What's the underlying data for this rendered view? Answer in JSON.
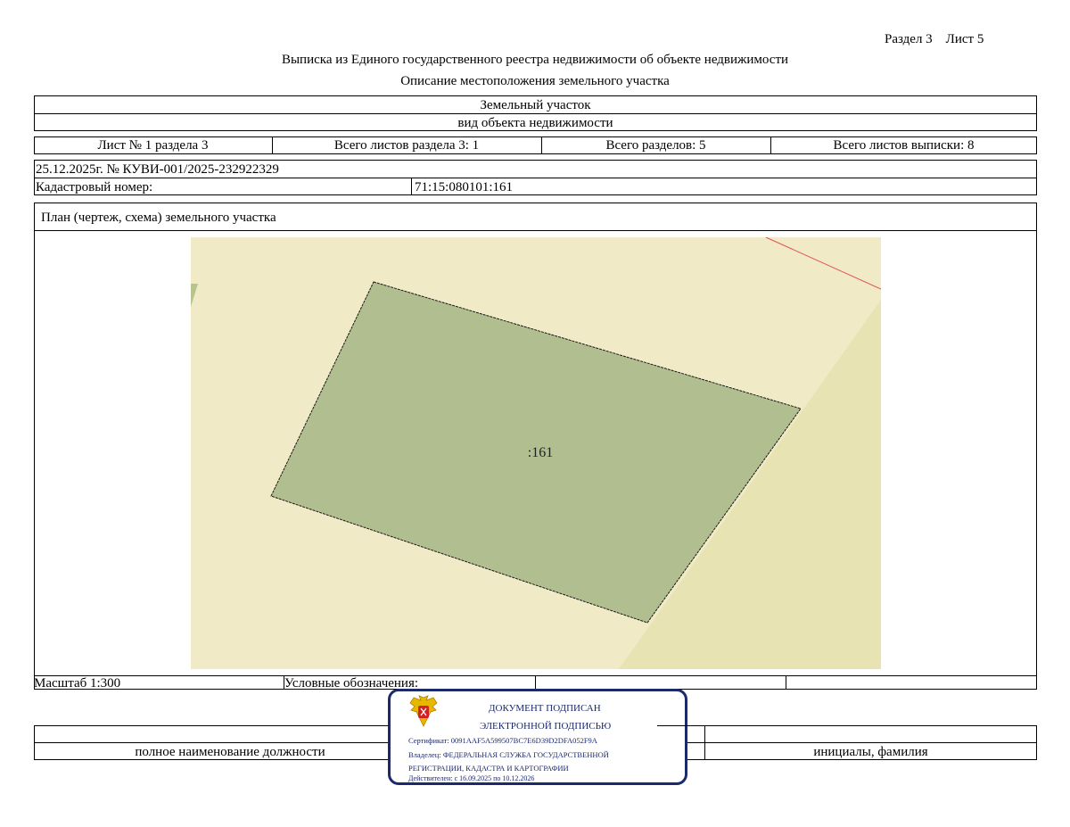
{
  "header": {
    "section_sheet": "Раздел 3    Лист 5",
    "title": "Выписка из Единого государственного реестра недвижимости об объекте недвижимости",
    "subtitle": "Описание местоположения земельного участка"
  },
  "object": {
    "type": "Земельный участок",
    "type_caption": "вид объекта недвижимости"
  },
  "sheets": {
    "sheet": "Лист № 1 раздела 3",
    "total_sheets_section": "Всего листов раздела 3: 1",
    "total_sections": "Всего разделов: 5",
    "total_sheets_extract": "Всего листов выписки: 8"
  },
  "record": {
    "date_number": "25.12.2025г. № КУВИ-001/2025-232922329",
    "cadastral_label": "Кадастровый номер:",
    "cadastral_value": "71:15:080101:161"
  },
  "plan": {
    "title": "План (чертеж, схема) земельного участка",
    "parcel_label": ":161",
    "colors": {
      "background": "#f0eac6",
      "parcel_fill": "#b1be8f",
      "neighbor_fill": "#e8e3b2",
      "boundary_line": "#e05050"
    }
  },
  "footer": {
    "scale": "Масштаб 1:300",
    "legend_label": "Условные обозначения:",
    "position_caption": "полное наименование должности",
    "name_caption": "инициалы, фамилия"
  },
  "stamp": {
    "line1": "ДОКУМЕНТ ПОДПИСАН",
    "line2": "ЭЛЕКТРОННОЙ ПОДПИСЬЮ",
    "certificate": "Сертификат: 0091AAF5A599507BC7E6D39D2DFA052F9A",
    "owner_line1": "Владелец: ФЕДЕРАЛЬНАЯ СЛУЖБА ГОСУДАРСТВЕННОЙ",
    "owner_line2": "РЕГИСТРАЦИИ, КАДАСТРА И КАРТОГРАФИИ",
    "valid": "Действителен: с 16.09.2025 по 10.12.2026",
    "emblem": "coat-of-arms-icon"
  }
}
